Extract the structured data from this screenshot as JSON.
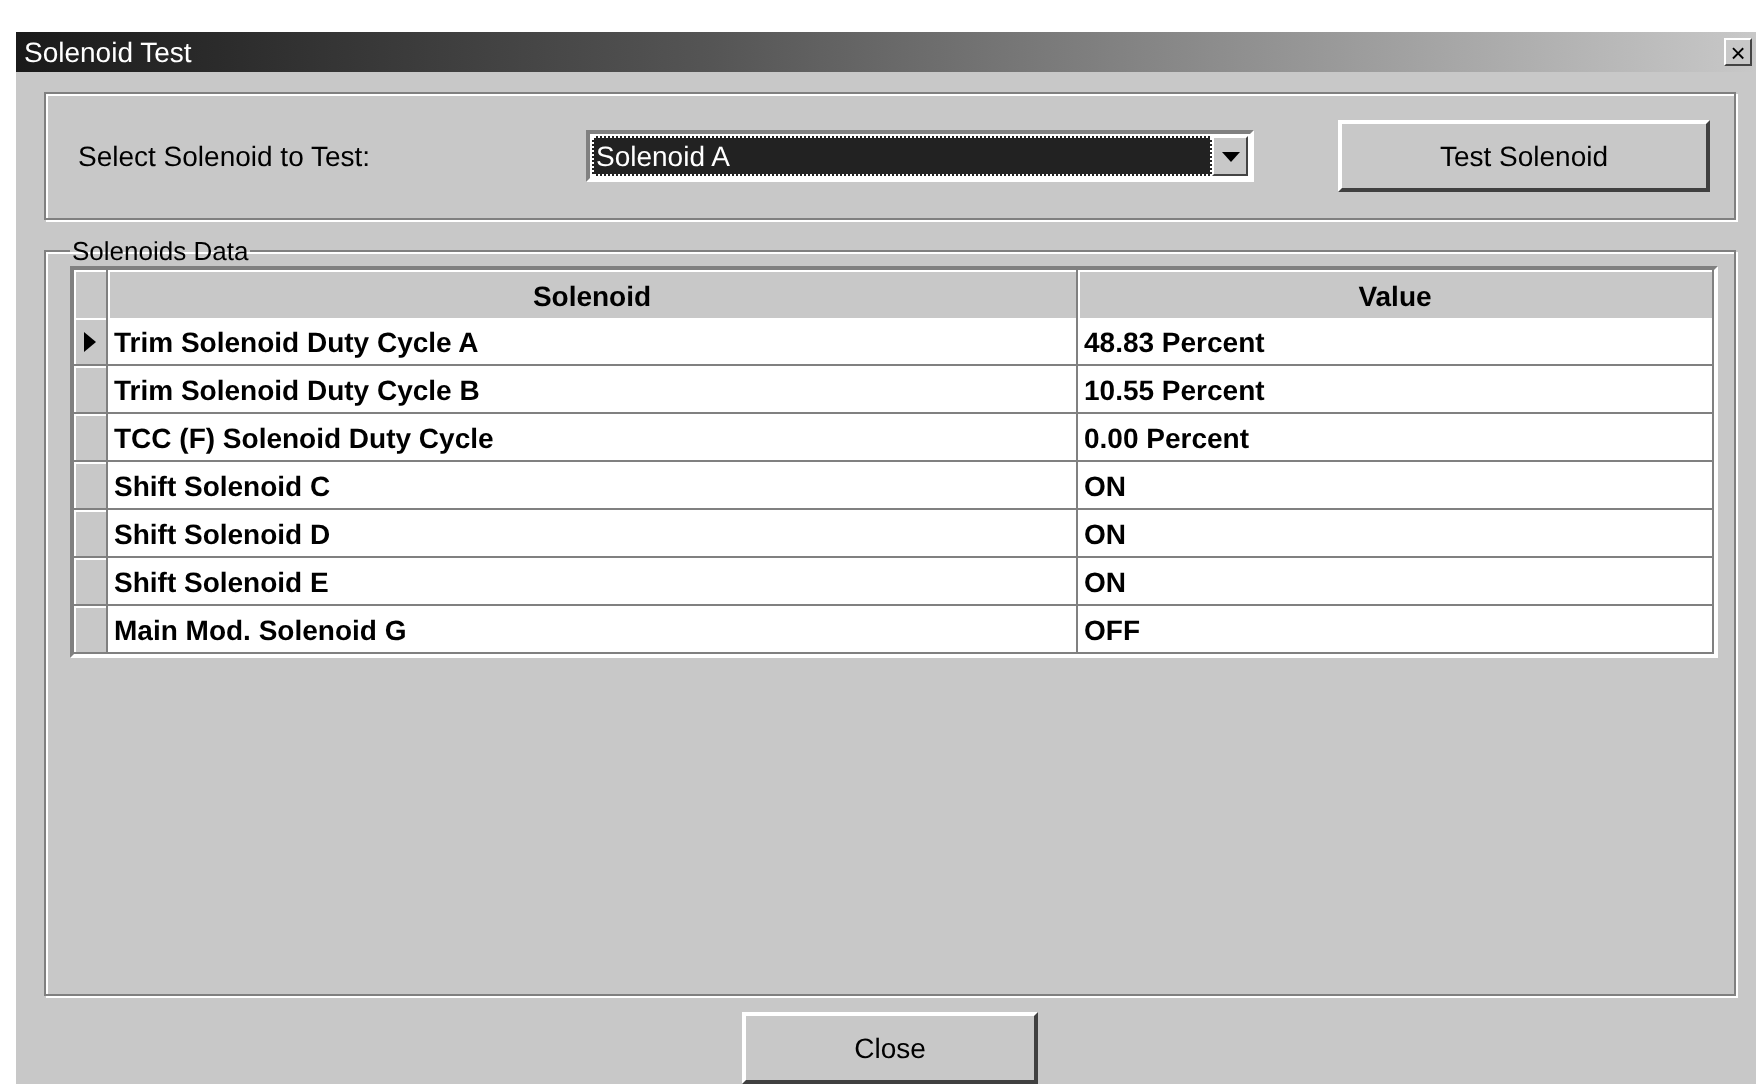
{
  "window": {
    "title": "Solenoid Test",
    "close_glyph": "×"
  },
  "selector": {
    "label": "Select Solenoid to Test:",
    "value": "Solenoid A",
    "button": "Test Solenoid"
  },
  "group": {
    "title": "Solenoids Data"
  },
  "table": {
    "columns": [
      "Solenoid",
      "Value"
    ],
    "rows": [
      {
        "name": "Trim Solenoid Duty Cycle A",
        "value": "48.83 Percent",
        "selected": true
      },
      {
        "name": "Trim Solenoid Duty Cycle B",
        "value": "10.55 Percent",
        "selected": false
      },
      {
        "name": "TCC (F) Solenoid Duty Cycle",
        "value": "0.00 Percent",
        "selected": false
      },
      {
        "name": "Shift Solenoid C",
        "value": "ON",
        "selected": false
      },
      {
        "name": "Shift Solenoid D",
        "value": "ON",
        "selected": false
      },
      {
        "name": "Shift Solenoid E",
        "value": "ON",
        "selected": false
      },
      {
        "name": "Main Mod. Solenoid G",
        "value": "OFF",
        "selected": false
      }
    ]
  },
  "buttons": [
    "Close"
  ]
}
